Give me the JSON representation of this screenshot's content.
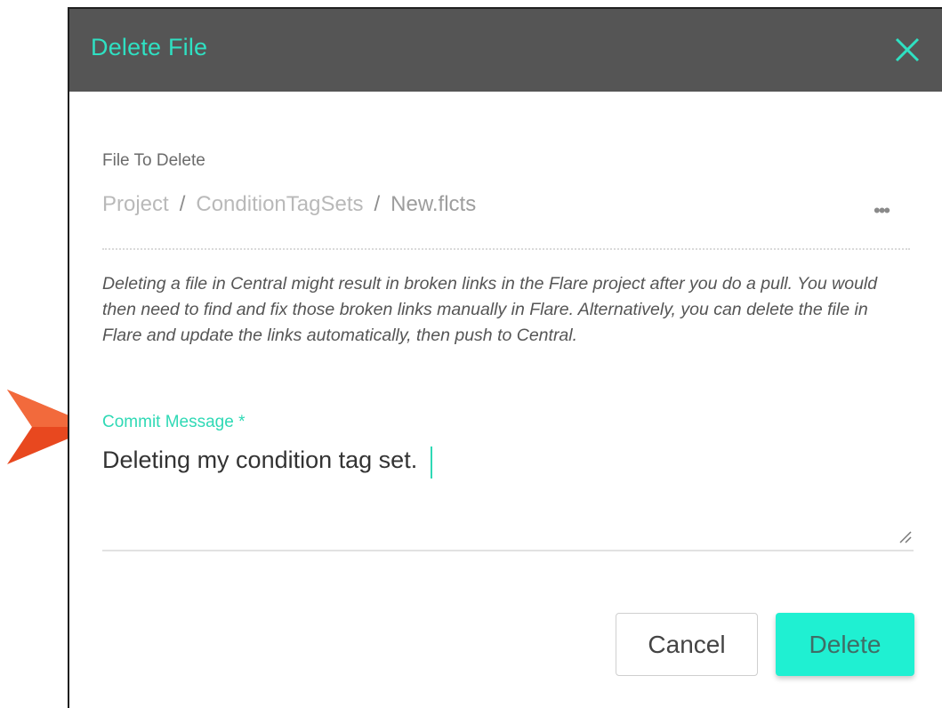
{
  "dialog": {
    "title": "Delete File",
    "close_icon": "close-icon",
    "accent_color": "#2fe0c2",
    "header_color": "#555555"
  },
  "file_to_delete": {
    "label": "File To Delete",
    "path": [
      "Project",
      "ConditionTagSets"
    ],
    "separator": "/",
    "filename": "New.flcts",
    "more_label": "•••"
  },
  "warning_text": "Deleting a file in Central might result in broken links in the Flare project after you do a pull. You would then need to find and fix those broken links manually in Flare. Alternatively, you can delete the file in Flare and update the links automatically, then push to Central.",
  "commit": {
    "label": "Commit Message *",
    "value": "Deleting my condition tag set."
  },
  "buttons": {
    "cancel": "Cancel",
    "delete": "Delete"
  },
  "annotation": {
    "arrow_icon": "pointer-arrow-icon",
    "arrow_color": "#e8481f"
  }
}
